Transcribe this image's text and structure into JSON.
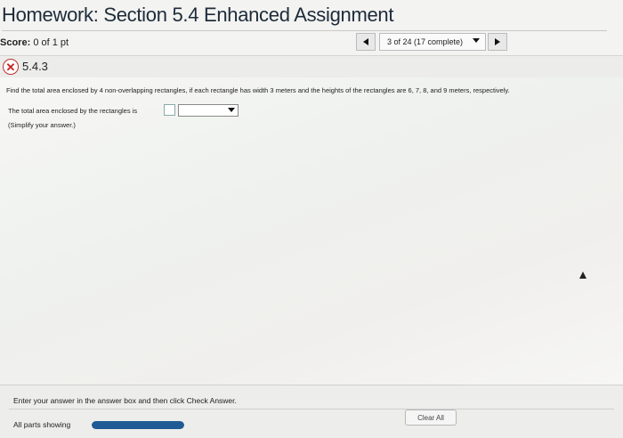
{
  "header": {
    "title": "Homework: Section 5.4 Enhanced Assignment",
    "score_label": "Score:",
    "score_value": "0 of 1 pt"
  },
  "navigation": {
    "question_position": "3 of 24 (17 complete)",
    "prev_icon": "triangle-left-icon",
    "next_icon": "triangle-right-icon"
  },
  "question": {
    "number": "5.4.3",
    "status_icon": "incorrect-x-icon",
    "status_color": "#c8201f",
    "prompt": "Find the total area enclosed by 4 non-overlapping rectangles, if each rectangle has width 3 meters and the heights of the rectangles are 6, 7, 8, and 9 meters, respectively.",
    "answer_label": "The total area enclosed by the rectangles is",
    "answer_value": "",
    "unit_select_value": "",
    "hint": "(Simplify your answer.)"
  },
  "footer": {
    "instruction": "Enter your answer in the answer box and then click Check Answer.",
    "parts_label": "All parts showing",
    "parts_progress": 1.0,
    "clear_button": "Clear All",
    "accent_color": "#1f5a94"
  }
}
